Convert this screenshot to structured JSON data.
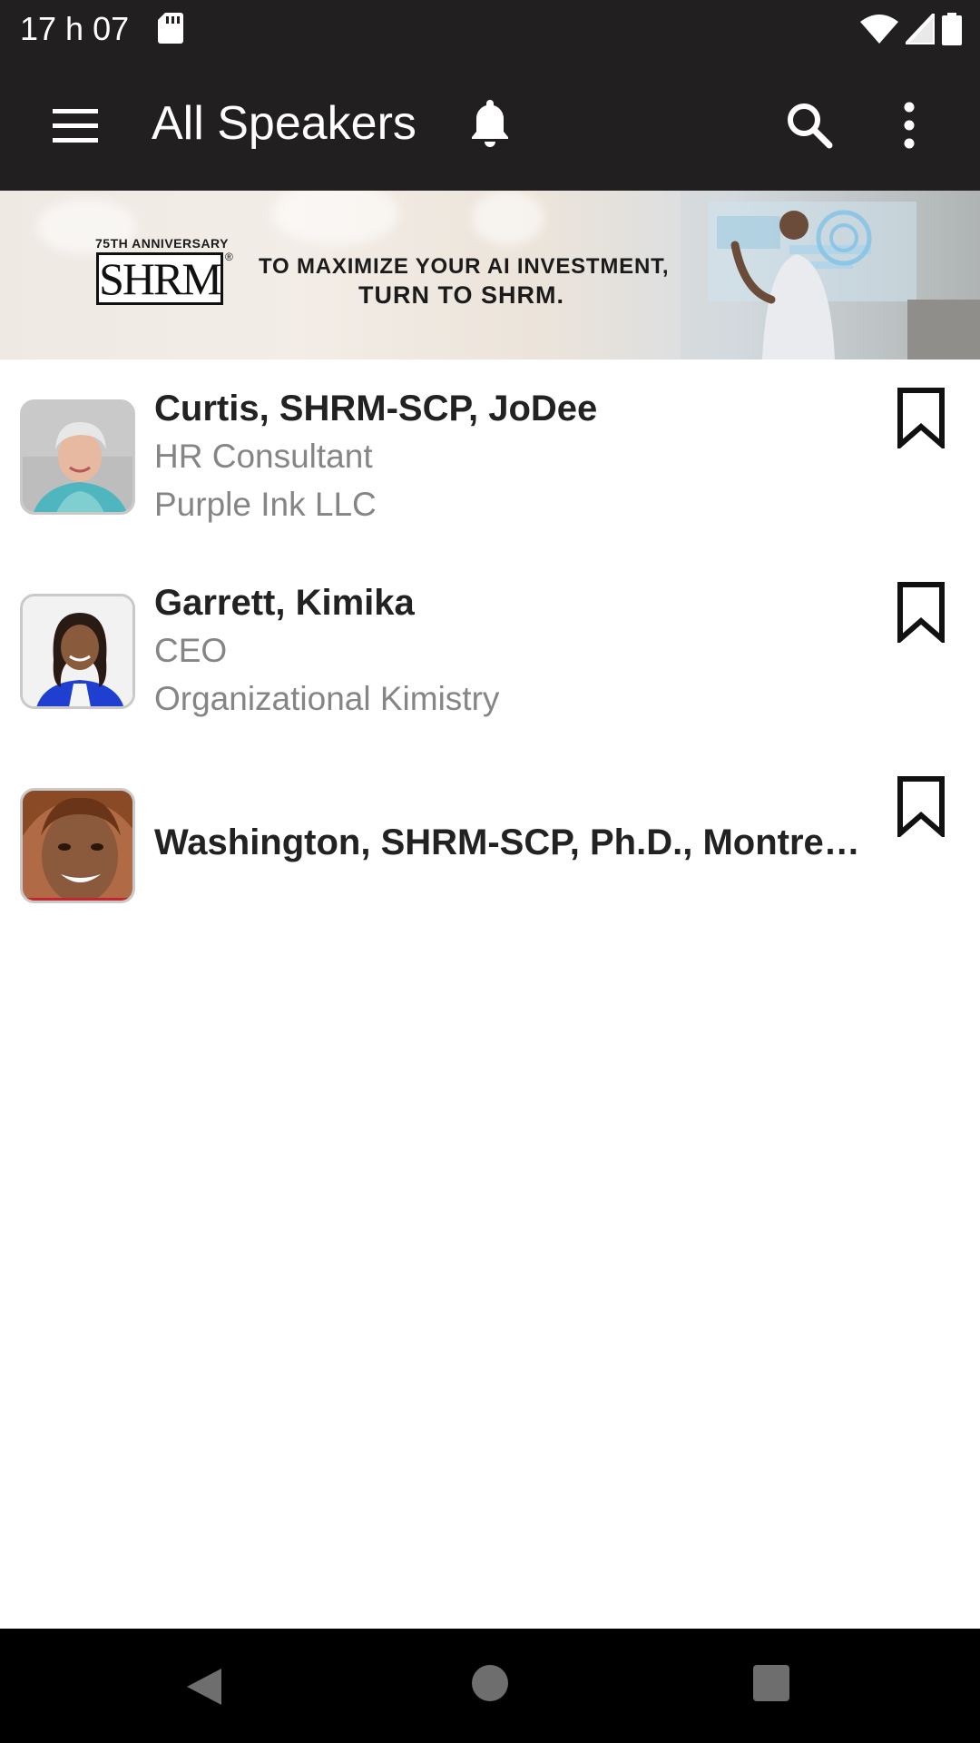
{
  "status_bar": {
    "time": "17 h 07",
    "icons": [
      "sd-card-icon",
      "wifi-icon",
      "signal-icon",
      "battery-icon"
    ]
  },
  "app_bar": {
    "title": "All Speakers",
    "icons": [
      "menu-icon",
      "bell-icon",
      "search-icon",
      "more-vert-icon"
    ]
  },
  "banner": {
    "anniversary": "75TH ANNIVERSARY",
    "logo": "SHRM",
    "line1": "TO MAXIMIZE YOUR AI INVESTMENT,",
    "line2": "TURN TO SHRM."
  },
  "speakers": [
    {
      "name": "Curtis, SHRM-SCP, JoDee",
      "title": "HR Consultant",
      "company": "Purple Ink LLC"
    },
    {
      "name": "Garrett, Kimika",
      "title": "CEO",
      "company": "Organizational Kimistry"
    },
    {
      "name": "Washington, SHRM-SCP, Ph.D., Montre…",
      "title": "",
      "company": ""
    }
  ],
  "nav_bar": {
    "icons": [
      "back-icon",
      "home-icon",
      "recents-icon"
    ]
  },
  "colors": {
    "app_bar": "#211f20",
    "subtitle_text": "#858585",
    "name_text": "#222222"
  }
}
